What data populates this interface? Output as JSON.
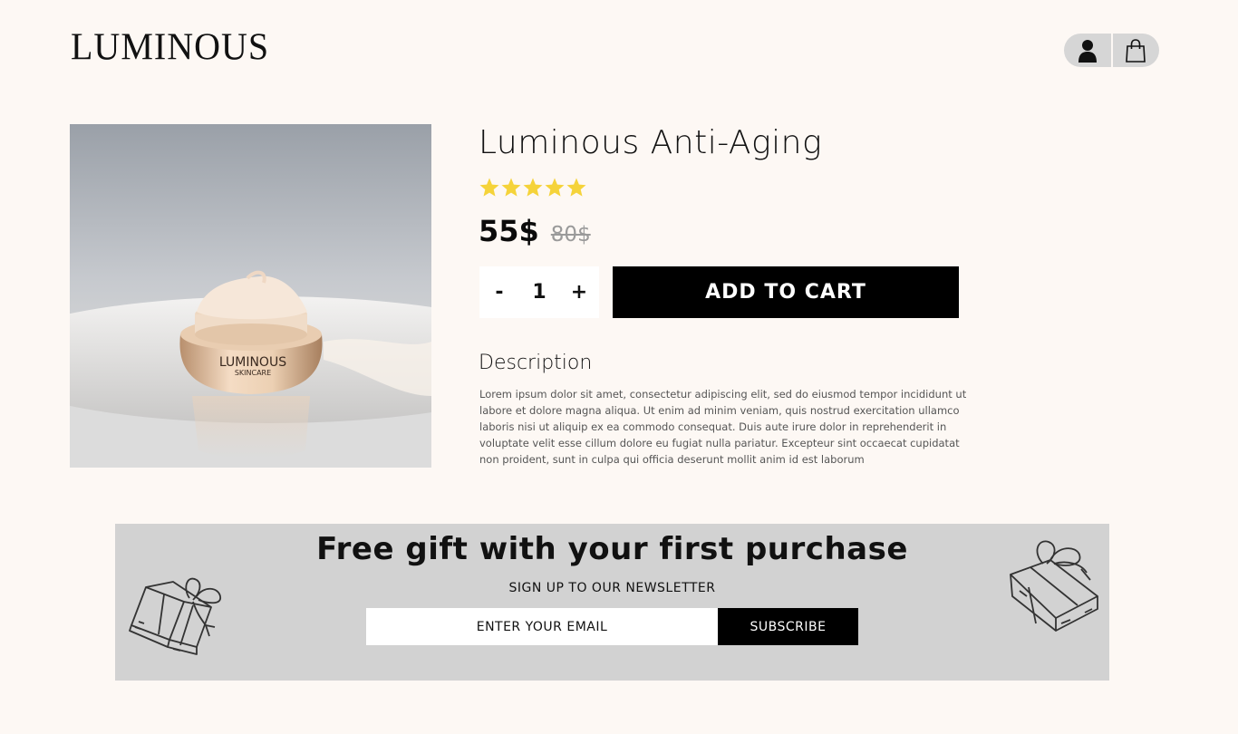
{
  "brand": {
    "logo_text": "LUMINOUS"
  },
  "header": {
    "icons": [
      "user-icon",
      "shopping-bag-icon"
    ]
  },
  "product": {
    "image_label_line1": "LUMINOUS",
    "image_label_line2": "SKINCARE",
    "title": "Luminous Anti-Aging",
    "rating": 5,
    "rating_max": 5,
    "price": "55$",
    "old_price": "80$",
    "quantity": "1",
    "qty_minus": "-",
    "qty_plus": "+",
    "add_to_cart_label": "ADD TO CART",
    "description_title": "Description",
    "description_text": "Lorem ipsum dolor sit amet, consectetur adipiscing elit, sed do eiusmod tempor incididunt ut labore et dolore magna aliqua. Ut enim ad minim veniam, quis nostrud exercitation ullamco laboris nisi ut aliquip ex ea commodo consequat. Duis aute irure dolor in reprehenderit in voluptate velit esse cillum dolore eu fugiat nulla pariatur. Excepteur sint occaecat cupidatat non proident, sunt in culpa qui officia deserunt mollit anim id est laborum"
  },
  "newsletter": {
    "title": "Free gift with your first purchase",
    "subtitle": "SIGN UP TO OUR NEWSLETTER",
    "email_placeholder": "ENTER YOUR EMAIL",
    "subscribe_label": "SUBSCRIBE"
  },
  "colors": {
    "background": "#fdf8f4",
    "star": "#f5d33a",
    "button": "#000000",
    "banner": "#d2d2d2"
  }
}
